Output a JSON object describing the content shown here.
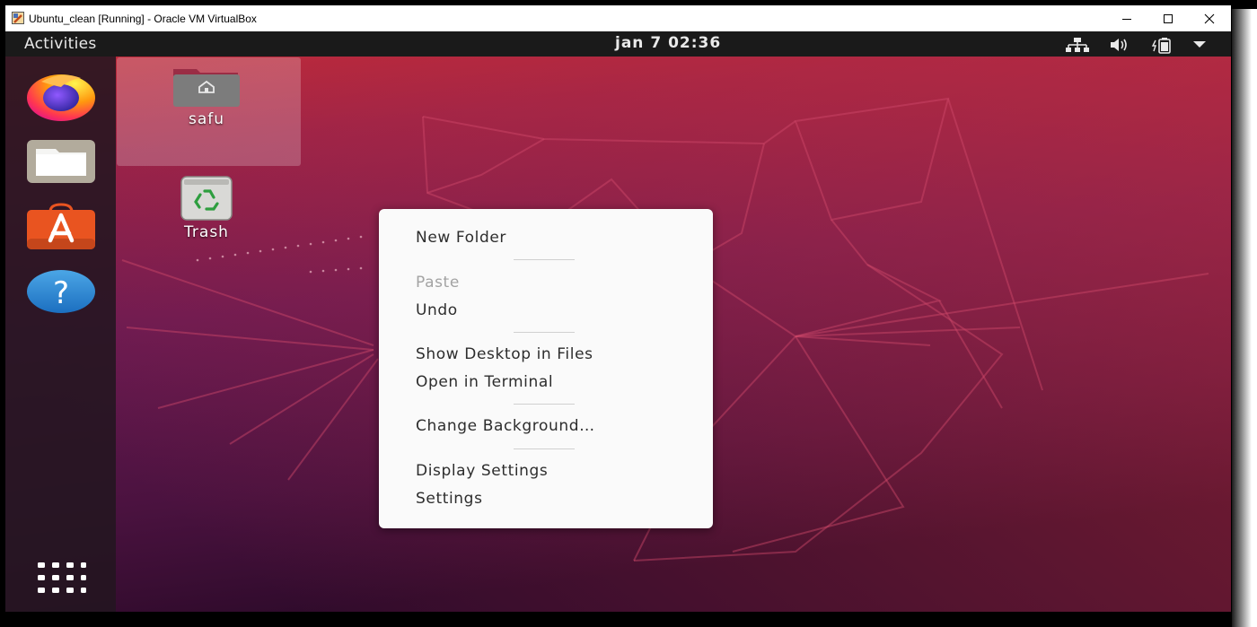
{
  "window": {
    "title": "Ubuntu_clean [Running] - Oracle VM VirtualBox"
  },
  "topbar": {
    "activities": "Activities",
    "clock": "jan 7  02:36",
    "tray": [
      "network-icon",
      "volume-icon",
      "battery-icon",
      "system-menu-arrow-icon"
    ]
  },
  "dock": {
    "apps": [
      {
        "name": "Firefox",
        "icon": "firefox-icon"
      },
      {
        "name": "Files",
        "icon": "files-icon"
      },
      {
        "name": "Ubuntu Software",
        "icon": "software-icon"
      },
      {
        "name": "Help",
        "icon": "help-icon"
      }
    ],
    "show_apps_icon": "app-grid-icon"
  },
  "desktop": {
    "icons": [
      {
        "label": "safu",
        "icon": "home-folder-icon",
        "selected": true
      },
      {
        "label": "Trash",
        "icon": "trash-icon",
        "selected": false
      }
    ]
  },
  "context_menu": {
    "items": [
      {
        "label": "New Folder",
        "enabled": true
      },
      {
        "label": "Paste",
        "enabled": false
      },
      {
        "label": "Undo",
        "enabled": true
      },
      {
        "label": "Show Desktop in Files",
        "enabled": true
      },
      {
        "label": "Open in Terminal",
        "enabled": true
      },
      {
        "label": "Change Background…",
        "enabled": true
      },
      {
        "label": "Display Settings",
        "enabled": true
      },
      {
        "label": "Settings",
        "enabled": true
      }
    ]
  },
  "colors": {
    "wallpaper_top": "#b8233a",
    "wallpaper_bottom": "#2c0a2e",
    "topbar": "#1a1a1a",
    "menu_bg": "#fafafa",
    "accent": "#e95420"
  }
}
